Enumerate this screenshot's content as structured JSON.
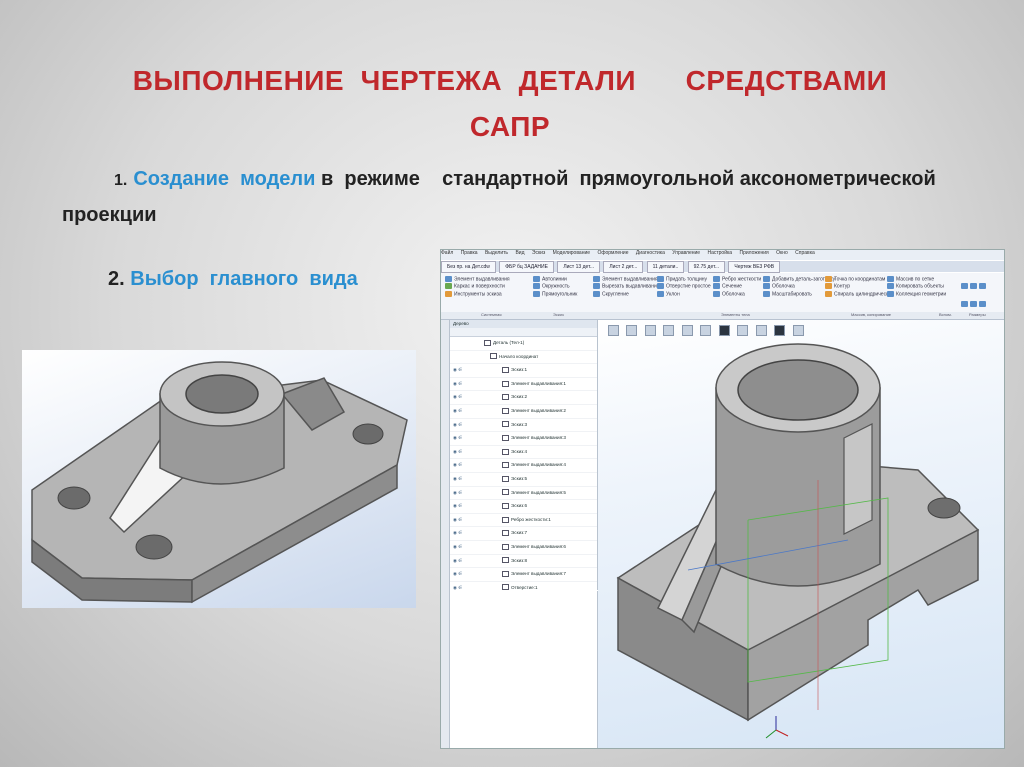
{
  "title": {
    "line1": "ВЫПОЛНЕНИЕ  ЧЕРТЕЖА  ДЕТАЛИ      СРЕДСТВАМИ",
    "line2": "САПР"
  },
  "step1": {
    "number": "1.",
    "highlight": "Создание  модели",
    "text": "в  режиме    стандартной  прямоугольной аксонометрической  проекции"
  },
  "step2": {
    "number": "2.",
    "highlight": "Выбор  главного  вида"
  },
  "colors": {
    "title": "#c0282c",
    "accent": "#2a8fd0",
    "model_face_light": "#b7b7b7",
    "model_face_dark": "#7d7d7d"
  },
  "cad": {
    "menu": [
      "Файл",
      "Правка",
      "Выделить",
      "Вид",
      "Эскиз",
      "Моделирование",
      "Оформление",
      "Диагностика",
      "Управление",
      "Настройка",
      "Приложения",
      "Окно",
      "Справка"
    ],
    "tabs": [
      "Без пр. на Дет.cdw",
      "ФБР бц ЗАДАНИЕ",
      "Лист 13 дет...",
      "Лист 2 дет...",
      "11 детали..",
      "92.75 дет...",
      "Чертеж ВЕ3 РФВ"
    ],
    "ribbon_groups": [
      {
        "items": [
          "Элемент выдавливания",
          "Каркас и поверхности",
          "Инструменты эскиза"
        ]
      },
      {
        "items": [
          "Автолинии",
          "Окружность",
          "Прямоугольник"
        ]
      },
      {
        "items": [
          "Элемент выдавливания",
          "Вырезать выдавливанием",
          "Скругление"
        ]
      },
      {
        "items": [
          "Придать толщину",
          "Отверстие простое",
          "Уклон"
        ]
      },
      {
        "items": [
          "Ребро жесткости",
          "Сечение",
          "Оболочка"
        ]
      },
      {
        "items": [
          "Добавить деталь-заготовку",
          "Оболочка",
          "Масштабировать"
        ]
      },
      {
        "items": [
          "Точка по координатам",
          "Контур",
          "Спираль цилиндрическая"
        ]
      },
      {
        "items": [
          "Массив по сетке",
          "Копировать объекты",
          "Коллекция геометрии"
        ]
      }
    ],
    "ribbon_labels": [
      "Системная",
      "Эскиз",
      "Элементы тела",
      "Массив, копирование",
      "Вспом.",
      "Размеры"
    ],
    "tree": {
      "header": "Дерево",
      "root": "Деталь (Тел-1)",
      "items": [
        "Начало координат",
        "Эскиз:1",
        "Элемент выдавливания:1",
        "Эскиз:2",
        "Элемент выдавливания:2",
        "Эскиз:3",
        "Элемент выдавливания:3",
        "Эскиз:4",
        "Элемент выдавливания:4",
        "Эскиз:5",
        "Элемент выдавливания:5",
        "Эскиз:6",
        "Ребро жесткости:1",
        "Эскиз:7",
        "Элемент выдавливания:6",
        "Эскиз:8",
        "Элемент выдавливания:7",
        "Отверстие:1"
      ]
    }
  }
}
